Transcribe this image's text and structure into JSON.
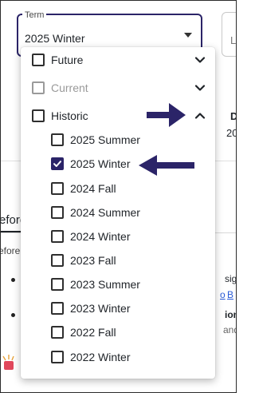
{
  "term_select": {
    "label": "Term",
    "value": "2025 Winter"
  },
  "menu": {
    "groups": [
      {
        "label": "Future",
        "checked": false,
        "disabled": false,
        "expanded": false
      },
      {
        "label": "Current",
        "checked": false,
        "disabled": true,
        "expanded": false
      },
      {
        "label": "Historic",
        "checked": false,
        "disabled": false,
        "expanded": true
      }
    ],
    "historic_options": [
      {
        "label": "2025 Summer",
        "checked": false
      },
      {
        "label": "2025 Winter",
        "checked": true
      },
      {
        "label": "2024 Fall",
        "checked": false
      },
      {
        "label": "2024 Summer",
        "checked": false
      },
      {
        "label": "2024 Winter",
        "checked": false
      },
      {
        "label": "2023 Fall",
        "checked": false
      },
      {
        "label": "2023 Summer",
        "checked": false
      },
      {
        "label": "2023 Winter",
        "checked": false
      },
      {
        "label": "2022 Fall",
        "checked": false
      },
      {
        "label": "2022 Winter",
        "checked": false
      }
    ]
  },
  "background": {
    "right_field_letter": "L",
    "right_heading_letter": "D",
    "right_value_fragment": "20",
    "tab_fragment": "efore",
    "para_fragment": "efore",
    "right_fragments": [
      "sig",
      "o",
      "B",
      "ion",
      "and"
    ],
    "bottom_fragment": "W"
  },
  "colors": {
    "accent": "#2b2468",
    "arrow": "#2b2468",
    "link": "#2a5bd7",
    "disabled": "#9a9a9a"
  }
}
